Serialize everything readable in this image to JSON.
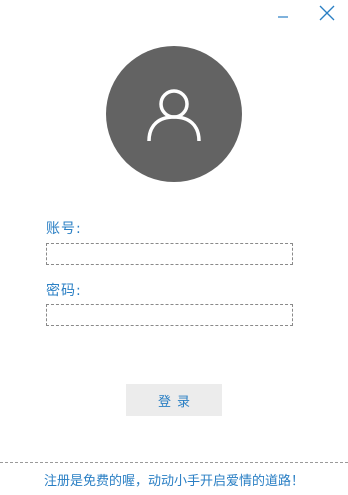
{
  "window": {
    "minimize_icon": "minimize-icon",
    "close_icon": "close-icon"
  },
  "avatar": {
    "icon": "user-icon",
    "background": "#636363"
  },
  "form": {
    "account_label": "账号:",
    "account_value": "",
    "password_label": "密码:",
    "password_value": "",
    "login_label": "登录"
  },
  "footer": {
    "text": "注册是免费的喔，动动小手开启爱情的道路！"
  },
  "colors": {
    "accent": "#2a7fc4",
    "button_bg": "#ececec"
  }
}
